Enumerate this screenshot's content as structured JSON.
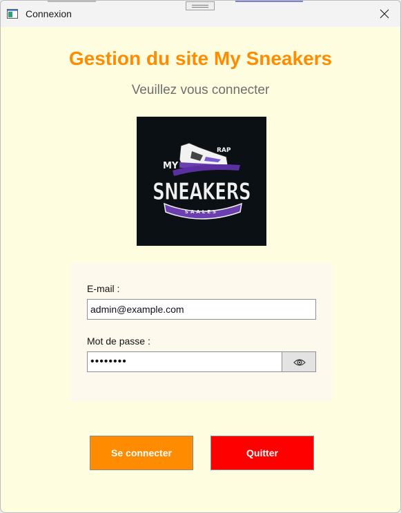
{
  "window": {
    "title": "Connexion"
  },
  "page": {
    "heading": "Gestion du site My Sneakers",
    "subheading": "Veuillez vous connecter"
  },
  "logo": {
    "alt": "My Sneakers logo",
    "word_top_left": "MY",
    "word_top_right": "RAP",
    "word_main": "SNEAKERS",
    "word_ribbon": "SAALES"
  },
  "form": {
    "email_label": "E-mail :",
    "email_value": "admin@example.com",
    "password_label": "Mot de passe :",
    "password_value": "••••••••"
  },
  "icons": {
    "app": "app-icon",
    "close": "close-icon",
    "show_password": "eye-icon"
  },
  "buttons": {
    "login": "Se connecter",
    "quit": "Quitter"
  },
  "colors": {
    "background": "#fffddf",
    "heading": "#ff8c00",
    "login_button": "#ff8c00",
    "quit_button": "#ff0000"
  }
}
